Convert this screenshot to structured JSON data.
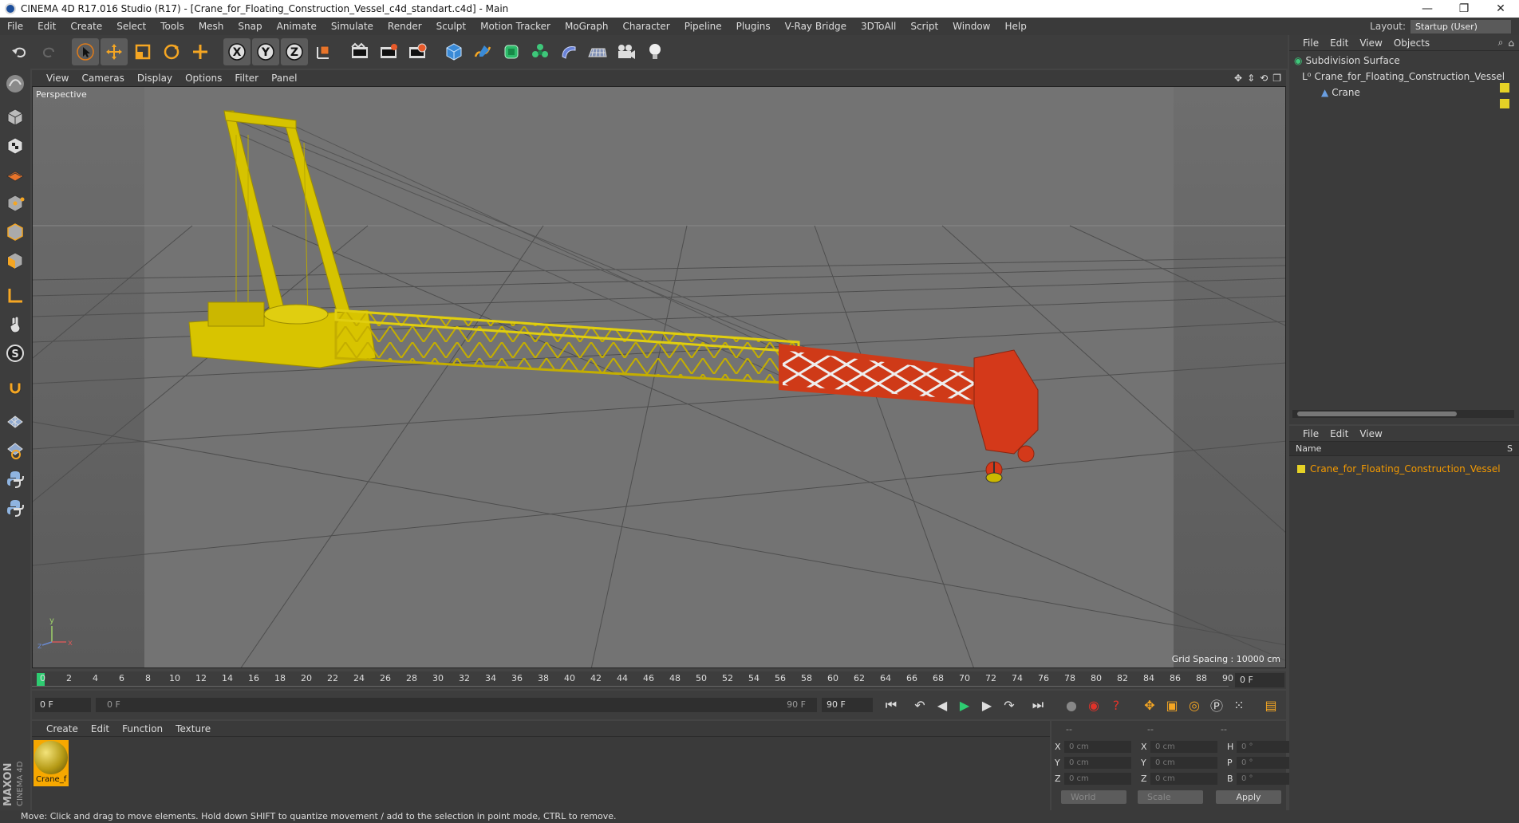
{
  "window": {
    "title": "CINEMA 4D R17.016 Studio (R17) - [Crane_for_Floating_Construction_Vessel_c4d_standart.c4d] - Main",
    "minimize": "—",
    "restore": "❐",
    "close": "✕"
  },
  "menubar": {
    "items": [
      "File",
      "Edit",
      "Create",
      "Select",
      "Tools",
      "Mesh",
      "Snap",
      "Animate",
      "Simulate",
      "Render",
      "Sculpt",
      "Motion Tracker",
      "MoGraph",
      "Character",
      "Pipeline",
      "Plugins",
      "V-Ray Bridge",
      "3DToAll",
      "Script",
      "Window",
      "Help"
    ],
    "layout_label": "Layout:",
    "layout_value": "Startup (User)"
  },
  "viewport": {
    "menu": [
      "View",
      "Cameras",
      "Display",
      "Options",
      "Filter",
      "Panel"
    ],
    "label": "Perspective",
    "grid_spacing": "Grid Spacing : 10000 cm"
  },
  "timeline": {
    "ticks": [
      "0",
      "2",
      "4",
      "6",
      "8",
      "10",
      "12",
      "14",
      "16",
      "18",
      "20",
      "22",
      "24",
      "26",
      "28",
      "30",
      "32",
      "34",
      "36",
      "38",
      "40",
      "42",
      "44",
      "46",
      "48",
      "50",
      "52",
      "54",
      "56",
      "58",
      "60",
      "62",
      "64",
      "66",
      "68",
      "70",
      "72",
      "74",
      "76",
      "78",
      "80",
      "82",
      "84",
      "86",
      "88",
      "90"
    ],
    "frame_field": "0 F"
  },
  "playback": {
    "start": "0 F",
    "range_start": "0 F",
    "range_end": "90 F",
    "end": "90 F"
  },
  "materials": {
    "menu": [
      "Create",
      "Edit",
      "Function",
      "Texture"
    ],
    "items": [
      {
        "name": "Crane_f"
      }
    ]
  },
  "coords": {
    "headers": [
      "--",
      "--",
      "--"
    ],
    "rows": [
      {
        "a": "X",
        "v1": "0 cm",
        "b": "X",
        "v2": "0 cm",
        "c": "H",
        "v3": "0 °"
      },
      {
        "a": "Y",
        "v1": "0 cm",
        "b": "Y",
        "v2": "0 cm",
        "c": "P",
        "v3": "0 °"
      },
      {
        "a": "Z",
        "v1": "0 cm",
        "b": "Z",
        "v2": "0 cm",
        "c": "B",
        "v3": "0 °"
      }
    ],
    "world": "World",
    "scale": "Scale",
    "apply": "Apply"
  },
  "object_manager": {
    "menu": [
      "File",
      "Edit",
      "View",
      "Objects"
    ],
    "tree": [
      "Subdivision Surface",
      "Crane_for_Floating_Construction_Vessel",
      "Crane"
    ]
  },
  "attribute_manager": {
    "menu": [
      "File",
      "Edit",
      "View"
    ],
    "col_name": "Name",
    "col_s": "S",
    "item": "Crane_for_Floating_Construction_Vessel"
  },
  "status": "Move: Click and drag to move elements. Hold down SHIFT to quantize movement / add to the selection in point mode, CTRL to remove.",
  "branding": {
    "line1": "MAXON",
    "line2": "CINEMA 4D"
  }
}
